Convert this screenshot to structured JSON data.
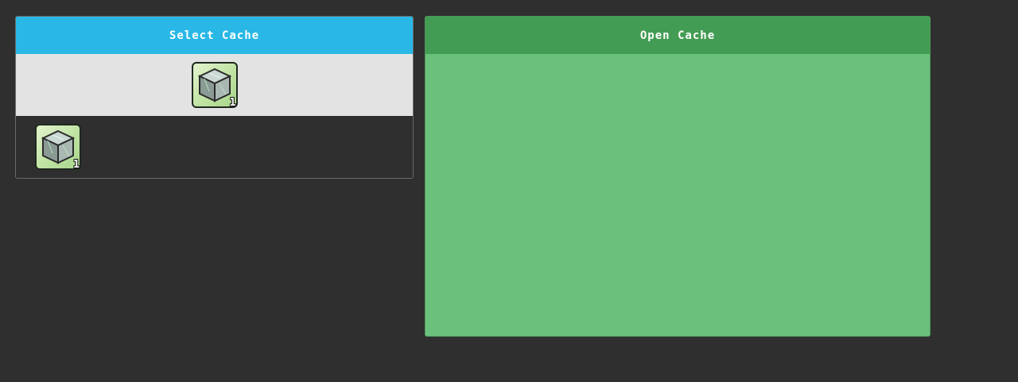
{
  "select_panel": {
    "title": "Select Cache",
    "selected_item": {
      "icon": "cache-cube-icon",
      "count": "1"
    },
    "items": [
      {
        "icon": "cache-cube-icon",
        "count": "1"
      }
    ]
  },
  "open_panel": {
    "title": "Open Cache"
  },
  "colors": {
    "background": "#2f2f2f",
    "select_header": "#29b8e6",
    "open_header": "#439c53",
    "open_body": "#6bc07b",
    "selected_row": "#e3e3e3"
  }
}
